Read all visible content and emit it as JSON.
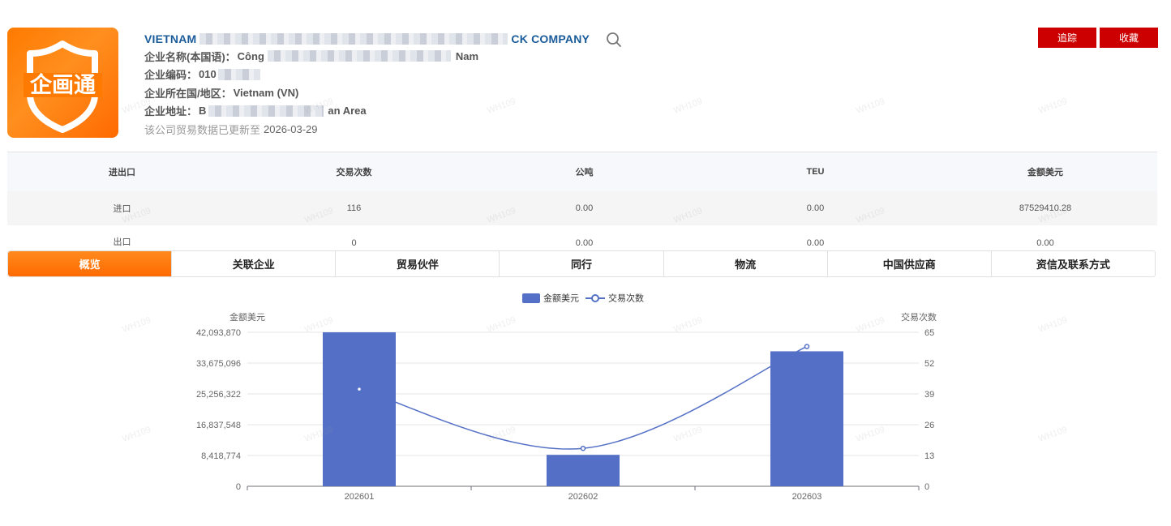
{
  "header": {
    "company_name_start": "VIETNAM",
    "company_name_end": "CK COMPANY",
    "fields": [
      {
        "label": "企业名称(本国语)：",
        "value_start": "Công",
        "value_end": "Nam"
      },
      {
        "label": "企业编码：",
        "value_start": "010",
        "value_end": ""
      },
      {
        "label": "企业所在国/地区：",
        "value_start": "Vietnam (VN)",
        "value_end": ""
      },
      {
        "label": "企业地址：",
        "value_start": "B",
        "value_end": "an Area"
      }
    ],
    "updated_label": "该公司贸易数据已更新至",
    "updated_date": "2026-03-29"
  },
  "logo": {
    "text": "企画通",
    "bg_color": "#ff7a00"
  },
  "actions": {
    "track_label": "追踪",
    "favorite_label": "收藏"
  },
  "stats": {
    "columns": [
      "进出口",
      "交易次数",
      "公吨",
      "TEU",
      "金额美元"
    ],
    "rows": [
      [
        "进口",
        "116",
        "0.00",
        "0.00",
        "87529410.28"
      ],
      [
        "出口",
        "0",
        "0.00",
        "0.00",
        "0.00"
      ]
    ]
  },
  "tabs": [
    "概览",
    "关联企业",
    "贸易伙伴",
    "同行",
    "物流",
    "中国供应商",
    "资信及联系方式"
  ],
  "watermark": "WH109",
  "chart_data": {
    "type": "bar",
    "categories": [
      "202601",
      "202602",
      "202603"
    ],
    "series": [
      {
        "name": "金额美元",
        "kind": "bar",
        "axis": "left",
        "values": [
          42093870,
          8600000,
          36900000
        ],
        "color": "#5470c6"
      },
      {
        "name": "交易次数",
        "kind": "line",
        "axis": "right",
        "values": [
          41,
          16,
          59
        ],
        "color": "#5470c6"
      }
    ],
    "ylabel": "金额美元",
    "y2label": "交易次数",
    "ylim": [
      0,
      42093870
    ],
    "y2lim": [
      0,
      65
    ],
    "yticks": [
      "0",
      "8,418,774",
      "16,837,548",
      "25,256,322",
      "33,675,096",
      "42,093,870"
    ],
    "y2ticks": [
      "0",
      "13",
      "26",
      "39",
      "52",
      "65"
    ],
    "legend": "top-center",
    "grid": true
  }
}
